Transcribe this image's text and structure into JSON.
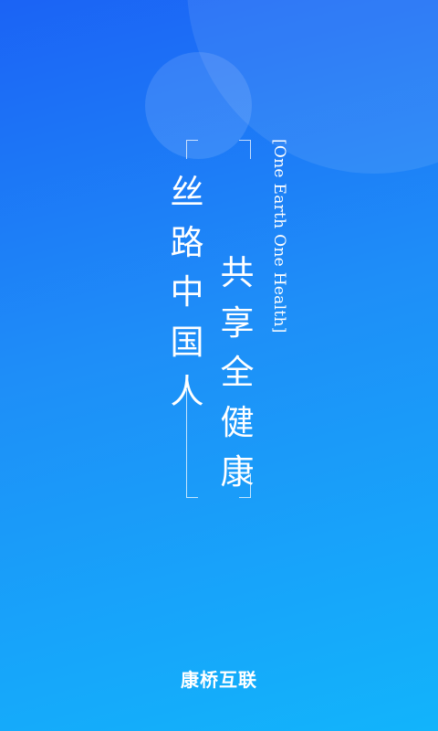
{
  "splash": {
    "slogan_line1": [
      "丝",
      "路",
      "中",
      "国",
      "人"
    ],
    "slogan_line2": [
      "共",
      "享",
      "全",
      "健",
      "康"
    ],
    "tagline": "[One Earth One Health]",
    "brand_name": "康桥互联"
  },
  "colors": {
    "gradient_top": "#1b63f5",
    "gradient_bottom": "#12b4fb",
    "text": "#ffffff"
  }
}
